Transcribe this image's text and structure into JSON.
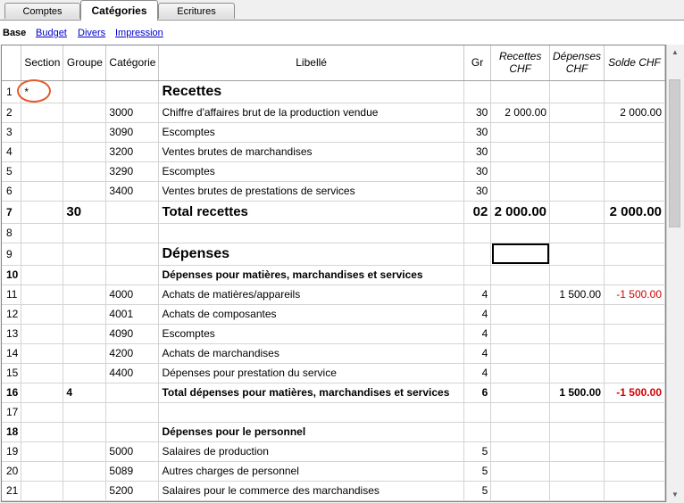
{
  "tabs": [
    "Comptes",
    "Catégories",
    "Ecritures"
  ],
  "subtabs": [
    "Base",
    "Budget",
    "Divers",
    "Impression"
  ],
  "columns": {
    "section": "Section",
    "groupe": "Groupe",
    "categorie": "Catégorie",
    "libelle": "Libellé",
    "gr": "Gr",
    "recettes": [
      "Recettes",
      "CHF"
    ],
    "depenses": [
      "Dépenses",
      "CHF"
    ],
    "solde": "Solde CHF"
  },
  "rows": [
    {
      "n": "1",
      "section": "*",
      "groupe": "",
      "cat": "",
      "lib": "Recettes",
      "gr": "",
      "rec": "",
      "dep": "",
      "solde": "",
      "style": "title"
    },
    {
      "n": "2",
      "section": "",
      "groupe": "",
      "cat": "3000",
      "lib": "Chiffre d'affaires brut de la production vendue",
      "gr": "30",
      "rec": "2 000.00",
      "dep": "",
      "solde": "2 000.00",
      "style": ""
    },
    {
      "n": "3",
      "section": "",
      "groupe": "",
      "cat": "3090",
      "lib": "Escomptes",
      "gr": "30",
      "rec": "",
      "dep": "",
      "solde": "",
      "style": ""
    },
    {
      "n": "4",
      "section": "",
      "groupe": "",
      "cat": "3200",
      "lib": "Ventes brutes de marchandises",
      "gr": "30",
      "rec": "",
      "dep": "",
      "solde": "",
      "style": ""
    },
    {
      "n": "5",
      "section": "",
      "groupe": "",
      "cat": "3290",
      "lib": "Escomptes",
      "gr": "30",
      "rec": "",
      "dep": "",
      "solde": "",
      "style": ""
    },
    {
      "n": "6",
      "section": "",
      "groupe": "",
      "cat": "3400",
      "lib": "Ventes brutes de prestations de services",
      "gr": "30",
      "rec": "",
      "dep": "",
      "solde": "",
      "style": ""
    },
    {
      "n": "7",
      "section": "",
      "groupe": "30",
      "cat": "",
      "lib": "Total recettes",
      "gr": "02",
      "rec": "2 000.00",
      "dep": "",
      "solde": "2 000.00",
      "style": "bigtotal"
    },
    {
      "n": "8",
      "section": "",
      "groupe": "",
      "cat": "",
      "lib": "",
      "gr": "",
      "rec": "",
      "dep": "",
      "solde": "",
      "style": ""
    },
    {
      "n": "9",
      "section": "",
      "groupe": "",
      "cat": "",
      "lib": "Dépenses",
      "gr": "",
      "rec": "",
      "dep": "",
      "solde": "",
      "style": "title"
    },
    {
      "n": "10",
      "section": "",
      "groupe": "",
      "cat": "",
      "lib": "Dépenses pour matières, marchandises et services",
      "gr": "",
      "rec": "",
      "dep": "",
      "solde": "",
      "style": "bold"
    },
    {
      "n": "11",
      "section": "",
      "groupe": "",
      "cat": "4000",
      "lib": "Achats de matières/appareils",
      "gr": "4",
      "rec": "",
      "dep": "1 500.00",
      "solde": "-1 500.00",
      "style": ""
    },
    {
      "n": "12",
      "section": "",
      "groupe": "",
      "cat": "4001",
      "lib": "Achats de composantes",
      "gr": "4",
      "rec": "",
      "dep": "",
      "solde": "",
      "style": ""
    },
    {
      "n": "13",
      "section": "",
      "groupe": "",
      "cat": "4090",
      "lib": "Escomptes",
      "gr": "4",
      "rec": "",
      "dep": "",
      "solde": "",
      "style": ""
    },
    {
      "n": "14",
      "section": "",
      "groupe": "",
      "cat": "4200",
      "lib": "Achats de marchandises",
      "gr": "4",
      "rec": "",
      "dep": "",
      "solde": "",
      "style": ""
    },
    {
      "n": "15",
      "section": "",
      "groupe": "",
      "cat": "4400",
      "lib": "Dépenses pour prestation du service",
      "gr": "4",
      "rec": "",
      "dep": "",
      "solde": "",
      "style": ""
    },
    {
      "n": "16",
      "section": "",
      "groupe": "4",
      "cat": "",
      "lib": "Total dépenses pour matières, marchandises et services",
      "gr": "6",
      "rec": "",
      "dep": "1 500.00",
      "solde": "-1 500.00",
      "style": "bold"
    },
    {
      "n": "17",
      "section": "",
      "groupe": "",
      "cat": "",
      "lib": "",
      "gr": "",
      "rec": "",
      "dep": "",
      "solde": "",
      "style": ""
    },
    {
      "n": "18",
      "section": "",
      "groupe": "",
      "cat": "",
      "lib": "Dépenses pour le personnel",
      "gr": "",
      "rec": "",
      "dep": "",
      "solde": "",
      "style": "bold"
    },
    {
      "n": "19",
      "section": "",
      "groupe": "",
      "cat": "5000",
      "lib": "Salaires de production",
      "gr": "5",
      "rec": "",
      "dep": "",
      "solde": "",
      "style": ""
    },
    {
      "n": "20",
      "section": "",
      "groupe": "",
      "cat": "5089",
      "lib": "Autres charges de personnel",
      "gr": "5",
      "rec": "",
      "dep": "",
      "solde": "",
      "style": ""
    },
    {
      "n": "21",
      "section": "",
      "groupe": "",
      "cat": "5200",
      "lib": "Salaires pour le commerce des marchandises",
      "gr": "5",
      "rec": "",
      "dep": "",
      "solde": "",
      "style": ""
    }
  ],
  "colors": {
    "negative": "#d40000",
    "highlight_circle": "#e05a2b",
    "link": "#0000cc"
  }
}
